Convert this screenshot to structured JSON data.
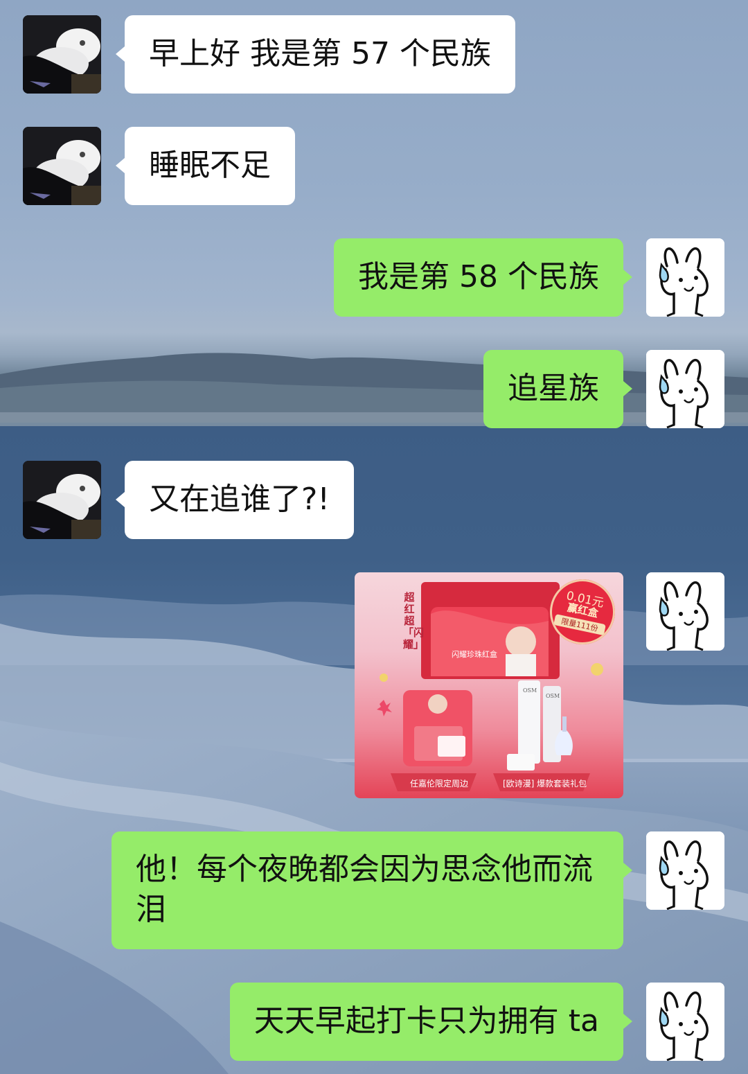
{
  "messages": [
    {
      "side": "in",
      "avatar": "cat-avatar",
      "text": "早上好 我是第 57 个民族"
    },
    {
      "side": "in",
      "avatar": "cat-avatar",
      "text": "睡眠不足"
    },
    {
      "side": "out",
      "avatar": "bunny-avatar",
      "text": "我是第 58 个民族"
    },
    {
      "side": "out",
      "avatar": "bunny-avatar",
      "text": "追星族"
    },
    {
      "side": "in",
      "avatar": "cat-avatar",
      "text": "又在追谁了?!"
    },
    {
      "side": "out",
      "avatar": "bunny-avatar",
      "type": "image",
      "image": {
        "vertical_text": "超红超「闪耀」",
        "badge_price": "0.01元",
        "badge_title": "赢红盒",
        "badge_limit": "限量111份",
        "card_title": "闪耀珍珠红盒",
        "label_left": "任嘉伦限定周边",
        "label_right": "[欧诗漫] 爆款套装礼包",
        "brand_mark": "OSM"
      }
    },
    {
      "side": "out",
      "avatar": "bunny-avatar",
      "text": "他！每个夜晚都会因为思念他而流泪"
    },
    {
      "side": "out",
      "avatar": "bunny-avatar",
      "text": "天天早起打卡只为拥有 ta"
    }
  ],
  "colors": {
    "incoming_bubble": "#ffffff",
    "outgoing_bubble": "#95ec69",
    "text": "#111111"
  },
  "icons": {
    "cat_avatar": "white-cat-photo-icon",
    "bunny_avatar": "crying-bunny-doodle-icon"
  }
}
